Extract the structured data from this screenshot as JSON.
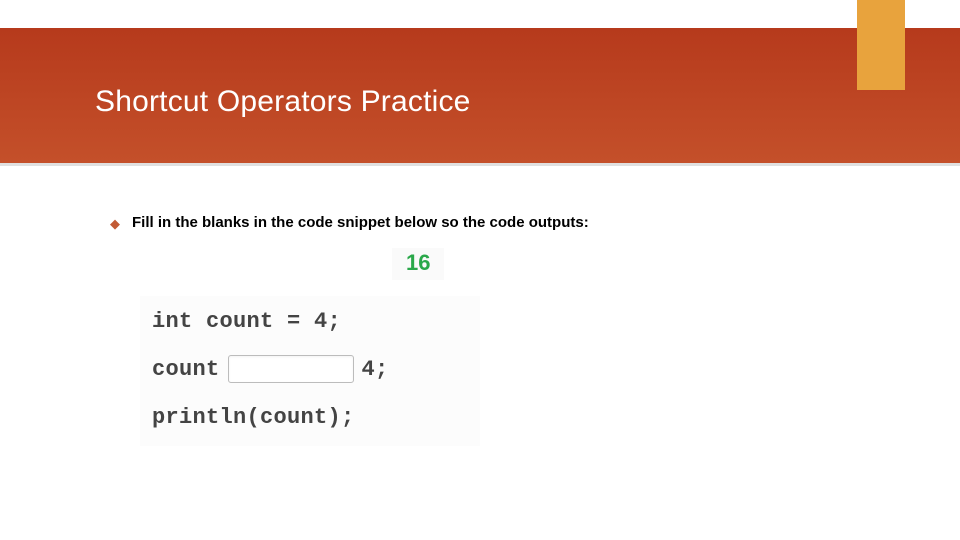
{
  "header": {
    "title": "Shortcut Operators Practice"
  },
  "bullet": {
    "text": "Fill in the blanks in the code snippet below so the code outputs:"
  },
  "output": {
    "value": "16"
  },
  "code": {
    "line1": "int count = 4;",
    "line2_pre": "count",
    "line2_post": "4;",
    "blank_value": "",
    "line3": "println(count);"
  }
}
